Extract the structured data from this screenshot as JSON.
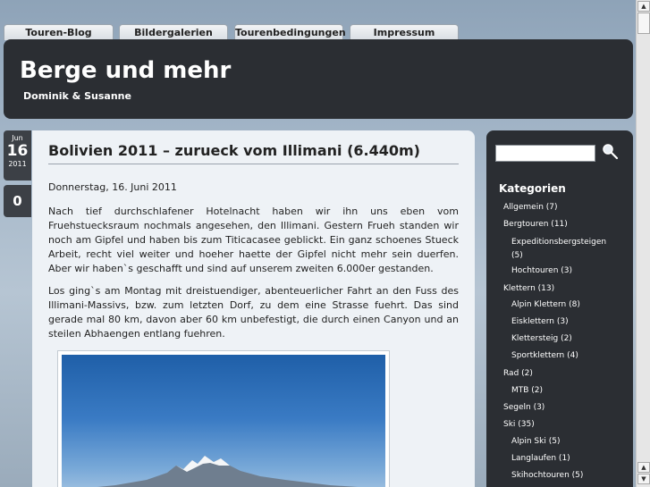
{
  "nav": {
    "tabs": [
      "Touren-Blog",
      "Bildergalerien",
      "Tourenbedingungen",
      "Impressum"
    ]
  },
  "header": {
    "title": "Berge und mehr",
    "subtitle": "Dominik & Susanne"
  },
  "post": {
    "date": {
      "month": "Jun",
      "day": "16",
      "year": "2011"
    },
    "comment_count": "0",
    "title": "Bolivien 2011 – zurueck vom Illimani (6.440m)",
    "dateline": "Donnerstag, 16. Juni 2011",
    "paragraphs": [
      "Nach tief durchschlafener Hotelnacht haben wir ihn uns eben vom Fruehstuecksraum nochmals angesehen, den Illimani. Gestern Frueh standen wir noch am Gipfel und haben bis zum Titicacasee geblickt. Ein ganz schoenes Stueck Arbeit, recht viel weiter und hoeher haette der Gipfel nicht mehr sein duerfen. Aber wir haben`s geschafft und sind auf unserem zweiten 6.000er gestanden.",
      "Los ging`s am Montag mit dreistuendiger, abenteuerlicher Fahrt an den Fuss des Illimani-Massivs, bzw. zum letzten Dorf, zu dem eine Strasse fuehrt. Das sind gerade mal 80 km, davon aber 60 km unbefestigt, die durch einen Canyon und an steilen Abhaengen entlang fuehren."
    ]
  },
  "sidebar": {
    "search_placeholder": "",
    "categories_title": "Kategorien",
    "categories": [
      {
        "label": "Allgemein (7)",
        "level": 0
      },
      {
        "label": "Bergtouren (11)",
        "level": 0
      },
      {
        "label": "Expeditionsbergsteigen (5)",
        "level": 1
      },
      {
        "label": "Hochtouren (3)",
        "level": 1
      },
      {
        "label": "Klettern (13)",
        "level": 0
      },
      {
        "label": "Alpin Klettern (8)",
        "level": 1
      },
      {
        "label": "Eisklettern (3)",
        "level": 1
      },
      {
        "label": "Klettersteig (2)",
        "level": 1
      },
      {
        "label": "Sportklettern (4)",
        "level": 1
      },
      {
        "label": "Rad (2)",
        "level": 0
      },
      {
        "label": "MTB (2)",
        "level": 1
      },
      {
        "label": "Segeln (3)",
        "level": 0
      },
      {
        "label": "Ski (35)",
        "level": 0
      },
      {
        "label": "Alpin Ski (5)",
        "level": 1
      },
      {
        "label": "Langlaufen (1)",
        "level": 1
      },
      {
        "label": "Skihochtouren (5)",
        "level": 1
      }
    ]
  },
  "colors": {
    "header_bg": "#2b2e33",
    "post_bg": "#eef2f6",
    "sky": "#3a7bc4"
  }
}
